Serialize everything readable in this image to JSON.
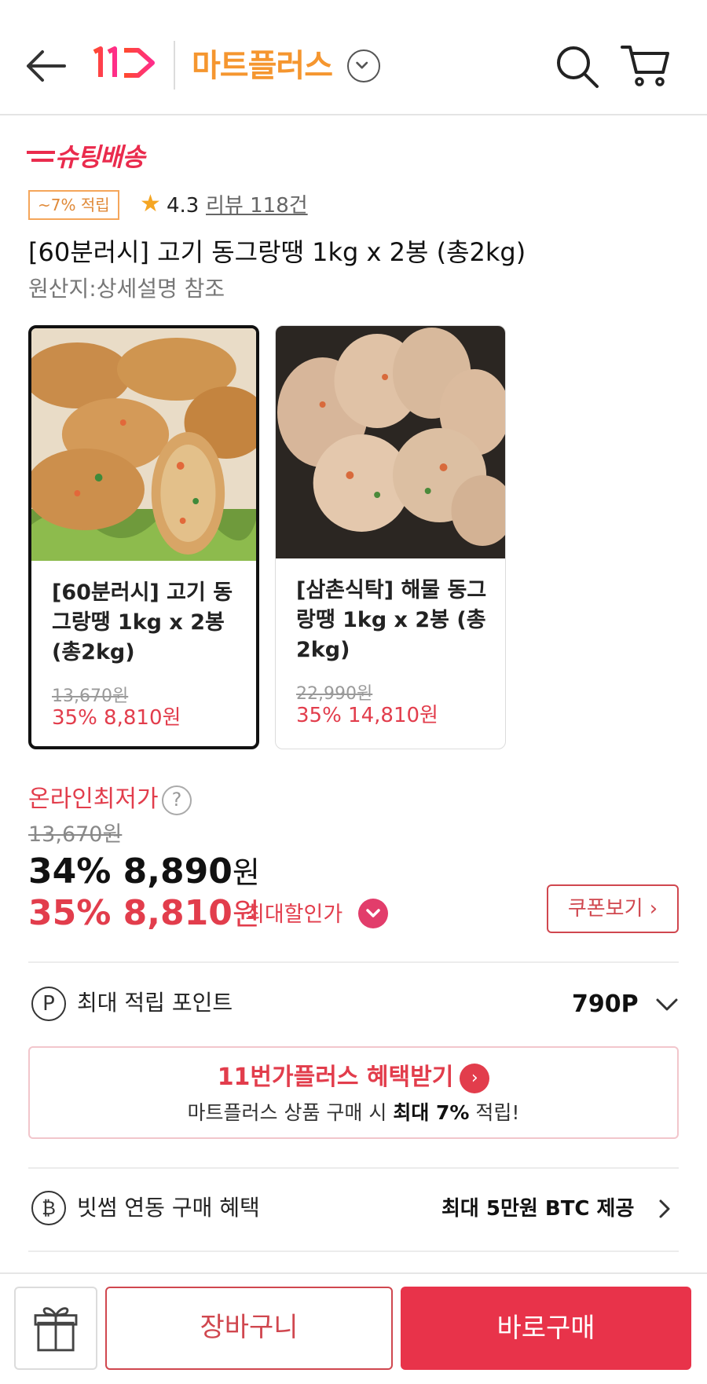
{
  "header": {
    "brand": "11",
    "store_title": "마트플러스"
  },
  "shooting": {
    "label": "슈팅배송"
  },
  "badges": {
    "reward": "~7% 적립",
    "rating": "4.3",
    "review": "리뷰 118건"
  },
  "product": {
    "title": "[60분러시] 고기 동그랑땡 1kg x 2봉 (총2kg)",
    "origin": "원산지:상세설명 참조"
  },
  "options": [
    {
      "name": "[60분러시] 고기 동그랑땡 1kg x 2봉 (총2kg)",
      "original_price": "13,670원",
      "sale_price": "35% 8,810원",
      "selected": true
    },
    {
      "name": "[삼촌식탁] 해물 동그랑땡 1kg x 2봉 (총2kg)",
      "original_price": "22,990원",
      "sale_price": "35% 14,810원",
      "selected": false
    }
  ],
  "pricing": {
    "lowest_label": "온라인최저가",
    "help": "?",
    "original": "13,670원",
    "main_price": "34% 8,890",
    "main_unit": "원",
    "best_price": "35% 8,810",
    "best_unit": "원",
    "best_label": "최대할인가",
    "coupon_button": "쿠폰보기 ›"
  },
  "points": {
    "icon_letter": "P",
    "label": "최대 적립 포인트",
    "value": "790P"
  },
  "plus_banner": {
    "title_brand": "11번가플러스",
    "title_action": "혜택받기",
    "sub_before": "마트플러스 상품 구매 시 ",
    "sub_bold": "최대 7%",
    "sub_after": " 적립!"
  },
  "btc": {
    "icon_letter": "₿",
    "label": "빗썸 연동 구매 혜택",
    "value": "최대 5만원 BTC 제공"
  },
  "bottom_bar": {
    "cart_label": "장바구니",
    "buy_label": "바로구매"
  },
  "colors": {
    "accent_red": "#e23d4c",
    "mart_orange": "#f5962f",
    "buy_button": "#e8334a"
  }
}
